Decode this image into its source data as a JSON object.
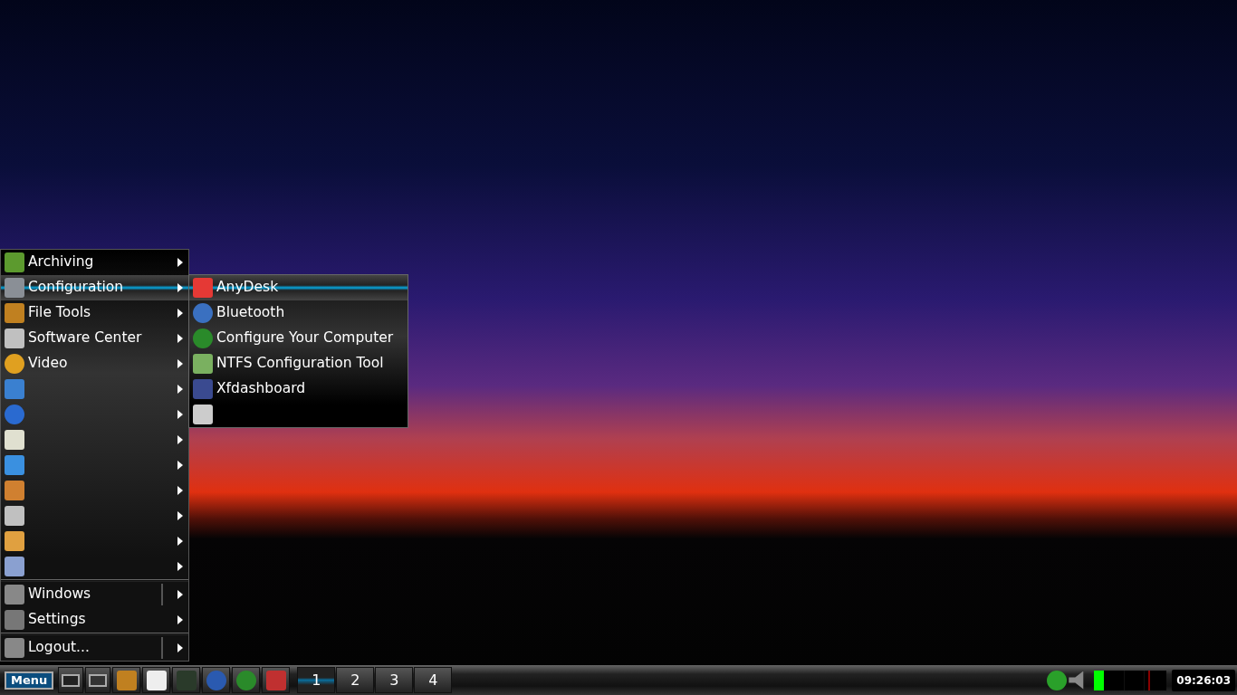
{
  "menu": {
    "sections": [
      [
        {
          "label": "Archiving",
          "selected": false,
          "split": false
        },
        {
          "label": "Configuration",
          "selected": true,
          "split": false
        },
        {
          "label": "File Tools",
          "selected": false,
          "split": false
        },
        {
          "label": "Software Center",
          "selected": false,
          "split": false
        },
        {
          "label": "Video",
          "selected": false,
          "split": false
        },
        {
          "selected": false,
          "split": false
        },
        {
          "selected": false,
          "split": false
        },
        {
          "selected": false,
          "split": false
        },
        {
          "selected": false,
          "split": false
        },
        {
          "selected": false,
          "split": false
        },
        {
          "selected": false,
          "split": false
        },
        {
          "selected": false,
          "split": false
        },
        {
          "selected": false,
          "split": false
        }
      ],
      [
        {
          "label": "Windows",
          "selected": false,
          "split": true
        },
        {
          "label": "Settings",
          "selected": false,
          "split": false
        }
      ],
      [
        {
          "label": "Logout...",
          "selected": false,
          "split": true
        }
      ]
    ]
  },
  "submenu": {
    "items": [
      {
        "label": "AnyDesk",
        "selected": true
      },
      {
        "label": "Bluetooth",
        "selected": false
      },
      {
        "label": "Configure Your Computer",
        "selected": false
      },
      {
        "label": "NTFS Configuration Tool",
        "selected": false
      },
      {
        "label": "Xfdashboard",
        "selected": false
      },
      {
        "selected": false
      }
    ]
  },
  "taskbar": {
    "menu_button": "Menu",
    "workspaces": [
      {
        "label": "1",
        "selected": true
      },
      {
        "label": "2",
        "selected": false
      },
      {
        "label": "3",
        "selected": false
      },
      {
        "label": "4",
        "selected": false
      }
    ],
    "clock": "09:26:03"
  }
}
